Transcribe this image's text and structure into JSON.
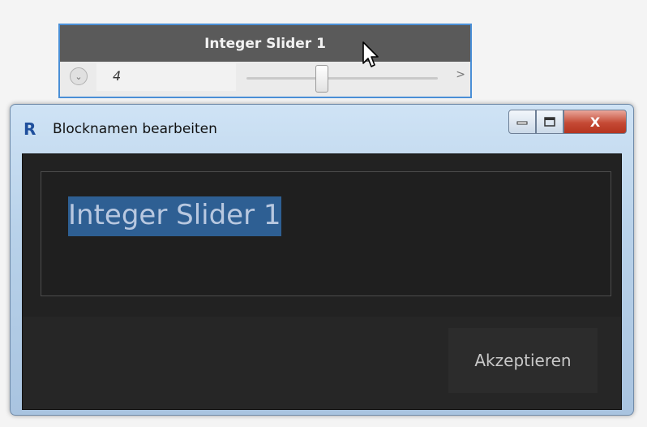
{
  "slider_node": {
    "title": "Integer Slider 1",
    "value": "4",
    "slider_fraction": 0.4,
    "next_symbol": ">",
    "expand_symbol": "⌄"
  },
  "dialog": {
    "app_icon_text": "R",
    "title": "Blocknamen bearbeiten",
    "name_value": "Integer Slider 1",
    "accept_label": "Akzeptieren",
    "close_symbol": "X"
  }
}
